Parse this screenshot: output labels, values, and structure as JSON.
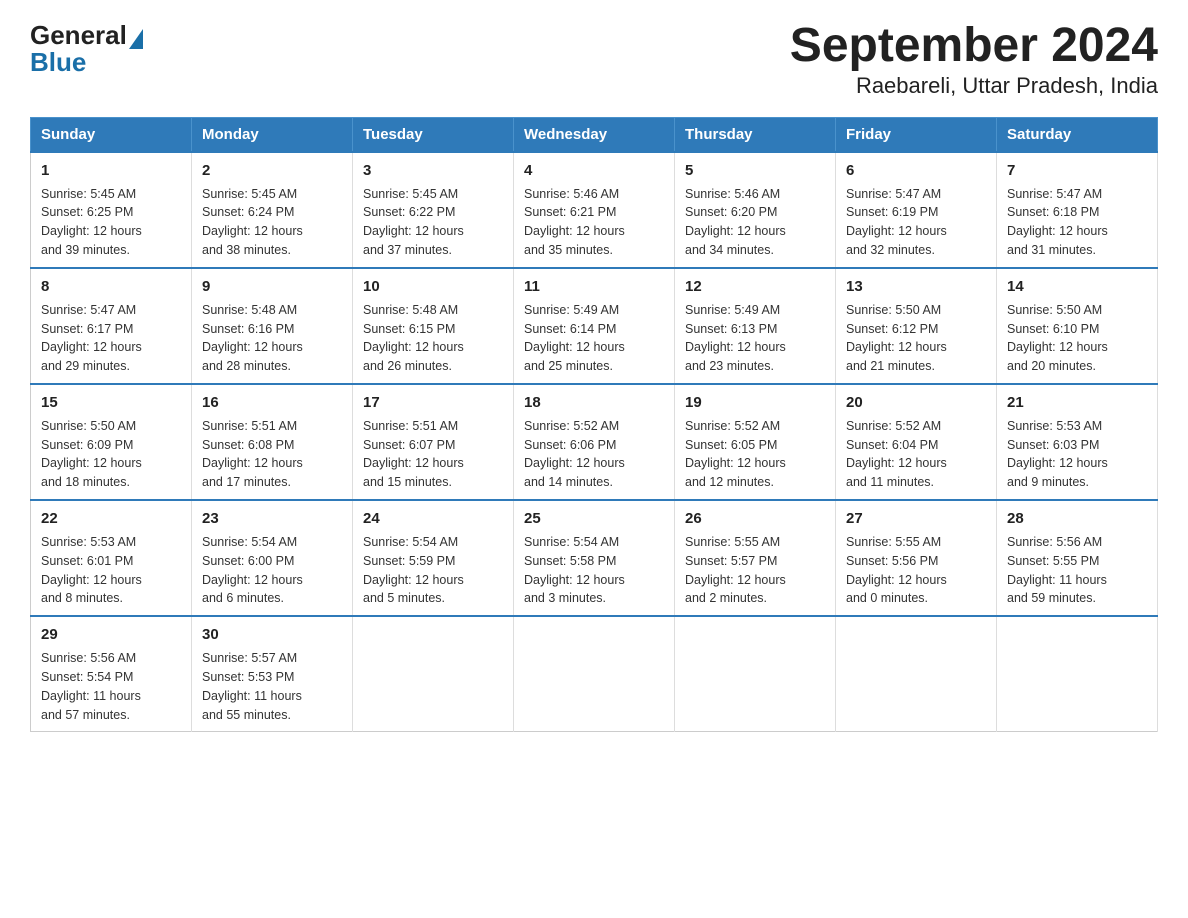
{
  "logo": {
    "general": "General",
    "triangle": "",
    "blue": "Blue"
  },
  "title": "September 2024",
  "subtitle": "Raebareli, Uttar Pradesh, India",
  "days": [
    "Sunday",
    "Monday",
    "Tuesday",
    "Wednesday",
    "Thursday",
    "Friday",
    "Saturday"
  ],
  "weeks": [
    [
      {
        "day": "1",
        "info": "Sunrise: 5:45 AM\nSunset: 6:25 PM\nDaylight: 12 hours\nand 39 minutes."
      },
      {
        "day": "2",
        "info": "Sunrise: 5:45 AM\nSunset: 6:24 PM\nDaylight: 12 hours\nand 38 minutes."
      },
      {
        "day": "3",
        "info": "Sunrise: 5:45 AM\nSunset: 6:22 PM\nDaylight: 12 hours\nand 37 minutes."
      },
      {
        "day": "4",
        "info": "Sunrise: 5:46 AM\nSunset: 6:21 PM\nDaylight: 12 hours\nand 35 minutes."
      },
      {
        "day": "5",
        "info": "Sunrise: 5:46 AM\nSunset: 6:20 PM\nDaylight: 12 hours\nand 34 minutes."
      },
      {
        "day": "6",
        "info": "Sunrise: 5:47 AM\nSunset: 6:19 PM\nDaylight: 12 hours\nand 32 minutes."
      },
      {
        "day": "7",
        "info": "Sunrise: 5:47 AM\nSunset: 6:18 PM\nDaylight: 12 hours\nand 31 minutes."
      }
    ],
    [
      {
        "day": "8",
        "info": "Sunrise: 5:47 AM\nSunset: 6:17 PM\nDaylight: 12 hours\nand 29 minutes."
      },
      {
        "day": "9",
        "info": "Sunrise: 5:48 AM\nSunset: 6:16 PM\nDaylight: 12 hours\nand 28 minutes."
      },
      {
        "day": "10",
        "info": "Sunrise: 5:48 AM\nSunset: 6:15 PM\nDaylight: 12 hours\nand 26 minutes."
      },
      {
        "day": "11",
        "info": "Sunrise: 5:49 AM\nSunset: 6:14 PM\nDaylight: 12 hours\nand 25 minutes."
      },
      {
        "day": "12",
        "info": "Sunrise: 5:49 AM\nSunset: 6:13 PM\nDaylight: 12 hours\nand 23 minutes."
      },
      {
        "day": "13",
        "info": "Sunrise: 5:50 AM\nSunset: 6:12 PM\nDaylight: 12 hours\nand 21 minutes."
      },
      {
        "day": "14",
        "info": "Sunrise: 5:50 AM\nSunset: 6:10 PM\nDaylight: 12 hours\nand 20 minutes."
      }
    ],
    [
      {
        "day": "15",
        "info": "Sunrise: 5:50 AM\nSunset: 6:09 PM\nDaylight: 12 hours\nand 18 minutes."
      },
      {
        "day": "16",
        "info": "Sunrise: 5:51 AM\nSunset: 6:08 PM\nDaylight: 12 hours\nand 17 minutes."
      },
      {
        "day": "17",
        "info": "Sunrise: 5:51 AM\nSunset: 6:07 PM\nDaylight: 12 hours\nand 15 minutes."
      },
      {
        "day": "18",
        "info": "Sunrise: 5:52 AM\nSunset: 6:06 PM\nDaylight: 12 hours\nand 14 minutes."
      },
      {
        "day": "19",
        "info": "Sunrise: 5:52 AM\nSunset: 6:05 PM\nDaylight: 12 hours\nand 12 minutes."
      },
      {
        "day": "20",
        "info": "Sunrise: 5:52 AM\nSunset: 6:04 PM\nDaylight: 12 hours\nand 11 minutes."
      },
      {
        "day": "21",
        "info": "Sunrise: 5:53 AM\nSunset: 6:03 PM\nDaylight: 12 hours\nand 9 minutes."
      }
    ],
    [
      {
        "day": "22",
        "info": "Sunrise: 5:53 AM\nSunset: 6:01 PM\nDaylight: 12 hours\nand 8 minutes."
      },
      {
        "day": "23",
        "info": "Sunrise: 5:54 AM\nSunset: 6:00 PM\nDaylight: 12 hours\nand 6 minutes."
      },
      {
        "day": "24",
        "info": "Sunrise: 5:54 AM\nSunset: 5:59 PM\nDaylight: 12 hours\nand 5 minutes."
      },
      {
        "day": "25",
        "info": "Sunrise: 5:54 AM\nSunset: 5:58 PM\nDaylight: 12 hours\nand 3 minutes."
      },
      {
        "day": "26",
        "info": "Sunrise: 5:55 AM\nSunset: 5:57 PM\nDaylight: 12 hours\nand 2 minutes."
      },
      {
        "day": "27",
        "info": "Sunrise: 5:55 AM\nSunset: 5:56 PM\nDaylight: 12 hours\nand 0 minutes."
      },
      {
        "day": "28",
        "info": "Sunrise: 5:56 AM\nSunset: 5:55 PM\nDaylight: 11 hours\nand 59 minutes."
      }
    ],
    [
      {
        "day": "29",
        "info": "Sunrise: 5:56 AM\nSunset: 5:54 PM\nDaylight: 11 hours\nand 57 minutes."
      },
      {
        "day": "30",
        "info": "Sunrise: 5:57 AM\nSunset: 5:53 PM\nDaylight: 11 hours\nand 55 minutes."
      },
      null,
      null,
      null,
      null,
      null
    ]
  ]
}
